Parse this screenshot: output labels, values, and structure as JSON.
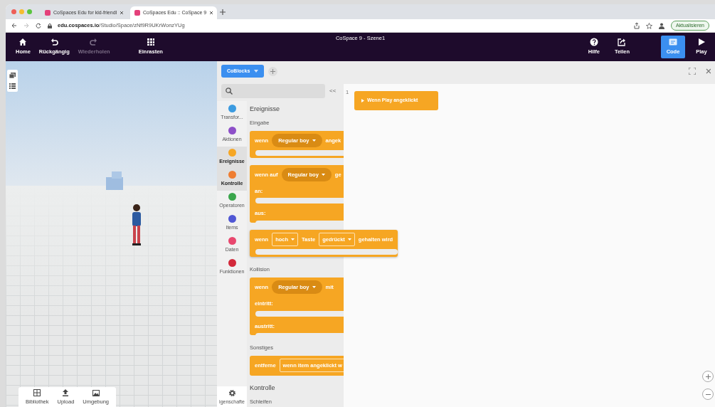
{
  "browser": {
    "tabs": [
      {
        "title": "CoSpaces Edu for kid-friendl",
        "selected": false
      },
      {
        "title": "CoSpaces Edu :: CoSpace 9",
        "selected": true
      }
    ],
    "address": {
      "host": "edu.cospaces.io",
      "path": "/Studio/Space/zNf9R9UKrWonzYUg"
    },
    "update_button": "Aktualisieren"
  },
  "app_bar": {
    "title": "CoSpace 9 - Szene1",
    "left_tools": [
      {
        "kind": "home",
        "label": "Home",
        "disabled": false
      },
      {
        "kind": "undo",
        "label": "Rückgängig",
        "disabled": false
      },
      {
        "kind": "redo",
        "label": "Wiederholen",
        "disabled": true
      },
      {
        "kind": "grid",
        "label": "Einrasten",
        "disabled": false
      }
    ],
    "right_tools": [
      {
        "kind": "help",
        "label": "Hilfe",
        "selected": false
      },
      {
        "kind": "share",
        "label": "Teilen",
        "selected": false
      },
      {
        "kind": "code",
        "label": "Code",
        "selected": true
      },
      {
        "kind": "play",
        "label": "Play",
        "selected": false
      }
    ]
  },
  "scene": {
    "bottom_tools": [
      {
        "kind": "library",
        "label": "Bibliothek"
      },
      {
        "kind": "upload",
        "label": "Upload"
      },
      {
        "kind": "environment",
        "label": "Umgebung"
      }
    ]
  },
  "code_panel": {
    "mode_button": "CoBlocks",
    "collapse_button": "<<",
    "categories": [
      {
        "label": "Transfor...",
        "color": "#3c9be0",
        "selected": false
      },
      {
        "label": "Aktionen",
        "color": "#8d4fc8",
        "selected": false
      },
      {
        "label": "Ereignisse",
        "color": "#f6a623",
        "selected": true
      },
      {
        "label": "Kontrolle",
        "color": "#ef7d31",
        "selected": true
      },
      {
        "label": "Operatoren",
        "color": "#3aa64c",
        "selected": false
      },
      {
        "label": "Items",
        "color": "#5057d4",
        "selected": false
      },
      {
        "label": "Daten",
        "color": "#e8476e",
        "selected": false
      },
      {
        "label": "Funktionen",
        "color": "#d3293b",
        "selected": false
      }
    ],
    "settings_label": "igenschafte",
    "toolbox": [
      {
        "kind": "heading",
        "text": "Ereignisse"
      },
      {
        "kind": "subheading",
        "text": "Eingabe"
      },
      {
        "kind": "block",
        "floating": false,
        "lines": [
          {
            "kind": "row",
            "parts": [
              {
                "kind": "text",
                "text": "wenn"
              },
              {
                "kind": "pill",
                "text": "Regular boy"
              },
              {
                "kind": "text",
                "text": "angek"
              }
            ]
          },
          {
            "kind": "slot"
          }
        ]
      },
      {
        "kind": "block",
        "floating": false,
        "lines": [
          {
            "kind": "row",
            "parts": [
              {
                "kind": "text",
                "text": "wenn auf"
              },
              {
                "kind": "pill",
                "text": "Regular boy"
              },
              {
                "kind": "text",
                "text": "ge"
              }
            ]
          },
          {
            "kind": "row",
            "parts": [
              {
                "kind": "text",
                "text": "an:"
              }
            ]
          },
          {
            "kind": "slot"
          },
          {
            "kind": "row",
            "parts": [
              {
                "kind": "text",
                "text": "aus:"
              }
            ]
          },
          {
            "kind": "slot"
          }
        ]
      },
      {
        "kind": "block",
        "floating": true,
        "lines": [
          {
            "kind": "row",
            "parts": [
              {
                "kind": "text",
                "text": "wenn"
              },
              {
                "kind": "field",
                "text": "hoch"
              },
              {
                "kind": "text",
                "text": "Taste"
              },
              {
                "kind": "field",
                "text": "gedrückt"
              },
              {
                "kind": "text",
                "text": "gehalten wird"
              }
            ]
          },
          {
            "kind": "slot"
          }
        ]
      },
      {
        "kind": "subheading",
        "text": "Kollision"
      },
      {
        "kind": "block",
        "floating": false,
        "lines": [
          {
            "kind": "row",
            "parts": [
              {
                "kind": "text",
                "text": "wenn"
              },
              {
                "kind": "pill",
                "text": "Regular boy"
              },
              {
                "kind": "text",
                "text": "mit"
              }
            ]
          },
          {
            "kind": "row",
            "parts": [
              {
                "kind": "text",
                "text": "eintritt:"
              }
            ]
          },
          {
            "kind": "slot"
          },
          {
            "kind": "row",
            "parts": [
              {
                "kind": "text",
                "text": "austritt:"
              }
            ]
          },
          {
            "kind": "slot"
          }
        ]
      },
      {
        "kind": "subheading",
        "text": "Sonstiges"
      },
      {
        "kind": "block",
        "floating": false,
        "lines": [
          {
            "kind": "row",
            "parts": [
              {
                "kind": "text",
                "text": "entferne"
              },
              {
                "kind": "input",
                "text": "wenn item angeklickt w"
              }
            ]
          }
        ]
      },
      {
        "kind": "heading",
        "text": "Kontrolle"
      },
      {
        "kind": "subheading",
        "text": "Schleifen"
      }
    ],
    "workspace": {
      "line_number": "1",
      "blocks": [
        {
          "text": "Wenn Play angeklickt"
        }
      ]
    }
  }
}
